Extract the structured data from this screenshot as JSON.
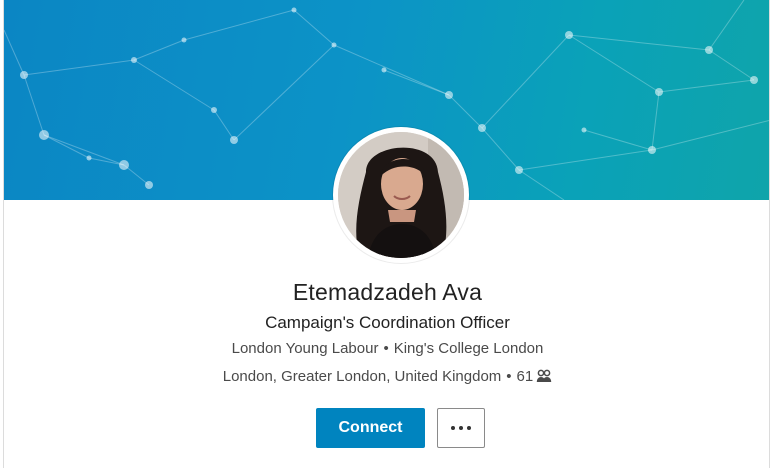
{
  "profile": {
    "name": "Etemadzadeh Ava",
    "headline": "Campaign's Coordination Officer",
    "organization": "London Young Labour",
    "education": "King's College London",
    "location": "London, Greater London, United Kingdom",
    "connections": "61"
  },
  "actions": {
    "connect_label": "Connect",
    "more_icon": "ellipsis-icon"
  },
  "icons": {
    "connections": "people-icon"
  },
  "colors": {
    "banner_start": "#0b86c4",
    "banner_end": "#0fa4aa",
    "primary_button": "#0084bf",
    "text": "#222222"
  }
}
